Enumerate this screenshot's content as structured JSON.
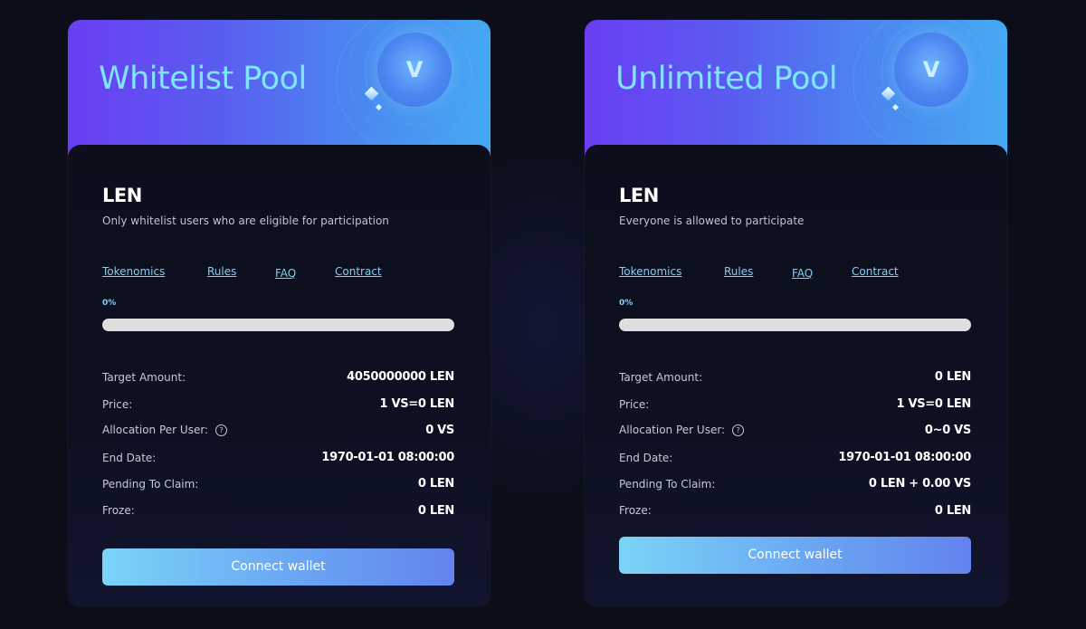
{
  "pools": [
    {
      "title": "Whitelist Pool",
      "token": "LEN",
      "description": "Only whitelist users who are eligible for participation",
      "links": {
        "tokenomics": "Tokenomics",
        "rules": "Rules",
        "faq": "FAQ",
        "contract": "Contract"
      },
      "progress": {
        "label": "0%",
        "fraction": 0
      },
      "rows": {
        "target_label": "Target Amount:",
        "target_value": "4050000000 LEN",
        "price_label": "Price:",
        "price_value": "1 VS=0 LEN",
        "allocation_label": "Allocation Per User:",
        "allocation_value": "0 VS",
        "end_label": "End Date:",
        "end_value": "1970-01-01 08:00:00",
        "pending_label": "Pending To Claim:",
        "pending_value": "0 LEN",
        "froze_label": "Froze:",
        "froze_value": "0 LEN"
      },
      "button_label": "Connect wallet"
    },
    {
      "title": "Unlimited Pool",
      "token": "LEN",
      "description": "Everyone is allowed to participate",
      "links": {
        "tokenomics": "Tokenomics",
        "rules": "Rules",
        "faq": "FAQ",
        "contract": "Contract"
      },
      "progress": {
        "label": "0%",
        "fraction": 0
      },
      "rows": {
        "target_label": "Target Amount:",
        "target_value": "0 LEN",
        "price_label": "Price:",
        "price_value": "1 VS=0 LEN",
        "allocation_label": "Allocation Per User:",
        "allocation_value": "0~0 VS",
        "end_label": "End Date:",
        "end_value": "1970-01-01 08:00:00",
        "pending_label": "Pending To Claim:",
        "pending_value": "0 LEN + 0.00 VS",
        "froze_label": "Froze:",
        "froze_value": "0 LEN"
      },
      "button_label": "Connect wallet"
    }
  ],
  "help_icon_glyph": "?",
  "logo_glyph": "V",
  "colors": {
    "accent": "#7fd0f5",
    "banner_start": "#6a3ef2",
    "banner_end": "#46a9f2",
    "title": "#7fe6ff",
    "page_bg": "#0b0d18"
  }
}
